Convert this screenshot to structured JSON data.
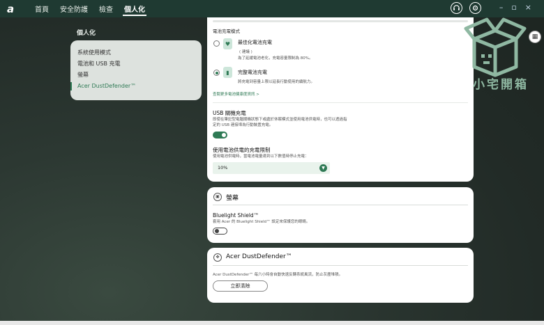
{
  "topbar": {
    "logo": "a",
    "nav": [
      "首頁",
      "安全防護",
      "檢查",
      "個人化"
    ],
    "active_index": 3,
    "icons": [
      "headset-icon",
      "settings-icon"
    ],
    "window_controls": [
      "minimize",
      "maximize",
      "close"
    ]
  },
  "sidebar": {
    "title": "個人化",
    "items": [
      {
        "label": "系統使用模式"
      },
      {
        "label": "電池和 USB 充電"
      },
      {
        "label": "螢幕"
      },
      {
        "label": "Acer DustDefender™"
      }
    ],
    "active_index": 3
  },
  "battery": {
    "section_label": "電池充電模式",
    "options": [
      {
        "title": "最佳化電池充電",
        "sub1": "( 建議 )",
        "sub2": "為了延緩電池老化，充電容量限制為 80%。",
        "checked": false
      },
      {
        "title": "完整電池充電",
        "sub1": "",
        "sub2": "將充電到容量上限以延長行動使用的續航力。",
        "checked": true
      }
    ],
    "link": "查閱更多電池健康度資訊 >"
  },
  "usb": {
    "title": "USB 關機充電",
    "desc1": "即使在筆記型電腦關機狀態下或處於休眠模式並使用電池供電時，也可以透過指",
    "desc2": "定的 USB 連接埠為行動裝置充電。",
    "enabled": true
  },
  "limit": {
    "title": "使用電池供電的充電限制",
    "desc": "使用電池供電時，當電池電量達到以下數值時停止充電：",
    "value": "10%"
  },
  "screen": {
    "title": "螢幕",
    "bls_title": "Bluelight Shield™",
    "bls_desc": "套用 Acer 的 Bluelight Shield™ 設定來保護您的眼睛。",
    "enabled": false
  },
  "dust": {
    "title": "Acer DustDefender™",
    "desc": "Acer DustDefender™ 每六小時會自動快速反轉系統風流，防止灰塵堆積。",
    "button": "立即清除"
  },
  "watermark": {
    "text": "小宅開箱"
  },
  "colors": {
    "accent": "#2f7a55",
    "topbar": "#1f3a32"
  }
}
